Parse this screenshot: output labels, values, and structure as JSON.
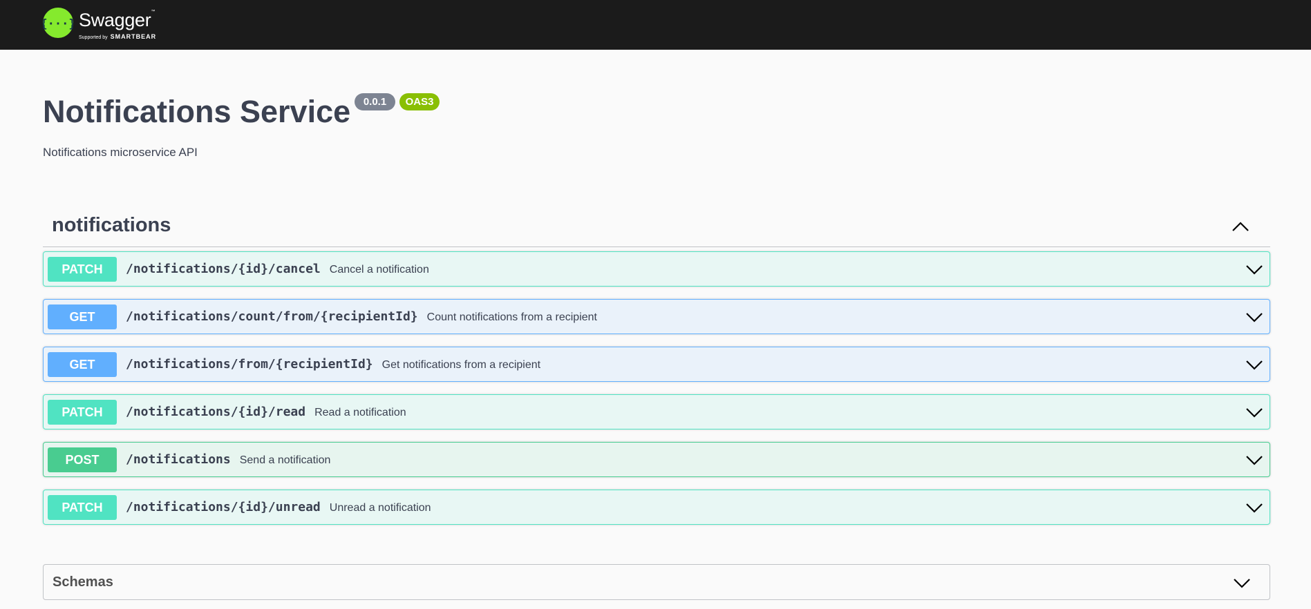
{
  "topbar": {
    "logo_text": "Swagger",
    "logo_supported": "Supported by",
    "logo_brand": "SMARTBEAR"
  },
  "info": {
    "title": "Notifications Service",
    "version": "0.0.1",
    "oas_badge": "OAS3",
    "description": "Notifications microservice API"
  },
  "tag": {
    "name": "notifications",
    "expanded": true
  },
  "operations": [
    {
      "method": "PATCH",
      "path": "/notifications/{id}/cancel",
      "summary": "Cancel a notification"
    },
    {
      "method": "GET",
      "path": "/notifications/count/from/{recipientId}",
      "summary": "Count notifications from a recipient"
    },
    {
      "method": "GET",
      "path": "/notifications/from/{recipientId}",
      "summary": "Get notifications from a recipient"
    },
    {
      "method": "PATCH",
      "path": "/notifications/{id}/read",
      "summary": "Read a notification"
    },
    {
      "method": "POST",
      "path": "/notifications",
      "summary": "Send a notification"
    },
    {
      "method": "PATCH",
      "path": "/notifications/{id}/unread",
      "summary": "Unread a notification"
    }
  ],
  "schemas": {
    "title": "Schemas"
  },
  "colors": {
    "patch": "#50e3c2",
    "get": "#61affe",
    "post": "#49cc90",
    "version_badge": "#7d8492",
    "oas_badge": "#89bf04",
    "topbar": "#1b1b1b",
    "logo": "#85ea2d"
  }
}
